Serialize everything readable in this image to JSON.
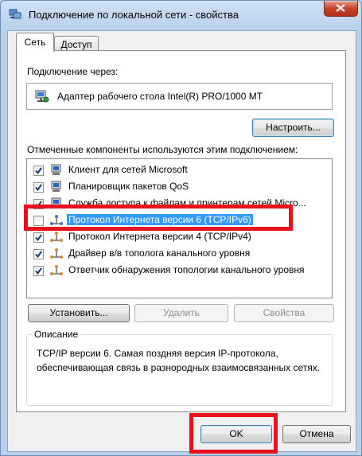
{
  "window": {
    "title": "Подключение по локальной сети - свойства"
  },
  "tabs": [
    {
      "label": "Сеть",
      "active": true
    },
    {
      "label": "Доступ",
      "active": false
    }
  ],
  "connect_using": {
    "label": "Подключение через:",
    "adapter": "Адаптер рабочего стола Intel(R) PRO/1000 MT",
    "configure_button": "Настроить..."
  },
  "components": {
    "label": "Отмеченные компоненты используются этим подключением:",
    "items": [
      {
        "label": "Клиент для сетей Microsoft",
        "checked": true,
        "icon": "network-client-icon"
      },
      {
        "label": "Планировщик пакетов QoS",
        "checked": true,
        "icon": "qos-scheduler-icon"
      },
      {
        "label": "Служба доступа к файлам и принтерам сетей Micro...",
        "checked": true,
        "icon": "file-printer-sharing-icon"
      },
      {
        "label": "Протокол Интернета версии 6 (TCP/IPv6)",
        "checked": false,
        "selected": true,
        "icon": "protocol-icon"
      },
      {
        "label": "Протокол Интернета версии 4 (TCP/IPv4)",
        "checked": true,
        "icon": "protocol-icon"
      },
      {
        "label": "Драйвер в/в тополога канального уровня",
        "checked": true,
        "icon": "protocol-icon"
      },
      {
        "label": "Ответчик обнаружения топологии канального уровня",
        "checked": true,
        "icon": "protocol-icon"
      }
    ]
  },
  "actions": {
    "install": "Установить...",
    "uninstall": "Удалить",
    "properties": "Свойства"
  },
  "description": {
    "title": "Описание",
    "text": "TCP/IP версии 6. Самая поздняя версия IP-протокола, обеспечивающая связь в разнородных взаимосвязанных сетях."
  },
  "footer": {
    "ok": "OK",
    "cancel": "Отмена"
  },
  "colors": {
    "highlight": "#3399ff",
    "annotation": "#e8121f"
  }
}
